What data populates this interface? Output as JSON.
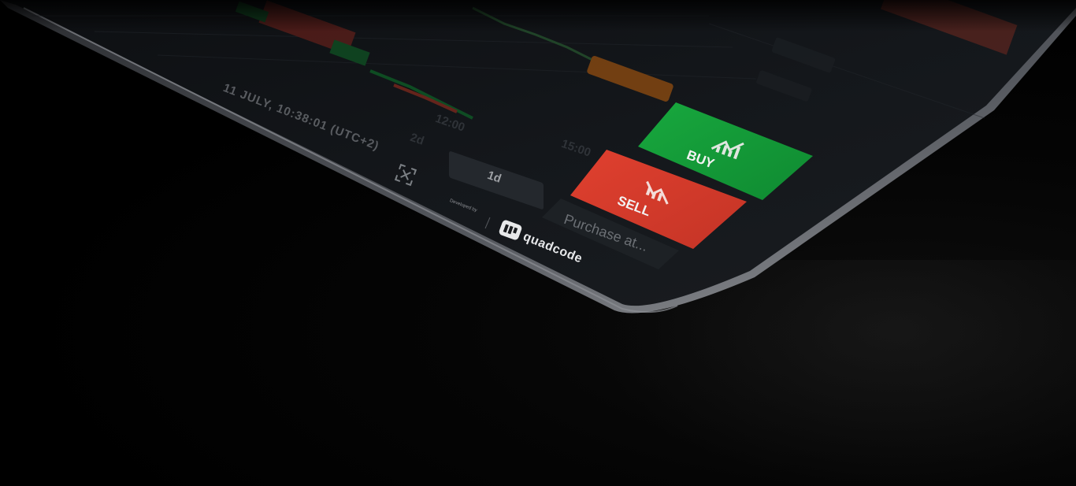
{
  "chart": {
    "timestamp": "11 JULY, 10:38:01 (UTC+2)",
    "periods": [
      "2d",
      "12:00",
      "1d",
      "15:00"
    ],
    "active_period": "1d"
  },
  "trade": {
    "buy_label": "BUY",
    "sell_label": "SELL",
    "purchase_placeholder": "Purchase at..."
  },
  "footer": {
    "developed_by": "Developed by",
    "brand": "quadcode"
  },
  "colors": {
    "buy": "#149a38",
    "sell": "#d83a2b",
    "background": "#000000",
    "panel": "#15181c",
    "accent_orange": "#f07a12"
  },
  "icons": [
    "fullscreen-icon",
    "buy-arrow-icon",
    "sell-arrow-icon",
    "quadcode-logo-icon"
  ]
}
